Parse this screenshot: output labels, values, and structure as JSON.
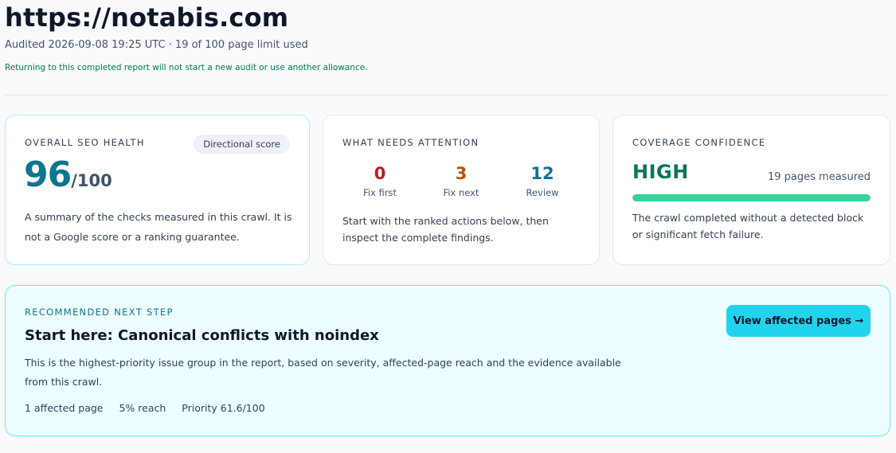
{
  "header": {
    "site_url": "https://notabis.com",
    "audit_meta": "Audited 2026-09-08 19:25 UTC · 19 of 100 page limit used",
    "note": "Returning to this completed report will not start a new audit or use another allowance."
  },
  "health": {
    "title": "OVERALL SEO HEALTH",
    "badge": "Directional score",
    "score": "96",
    "score_max": "/100",
    "description": "A summary of the checks measured in this crawl. It is not a Google score or a ranking guarantee."
  },
  "attention": {
    "title": "WHAT NEEDS ATTENTION",
    "counts": [
      {
        "value": "0",
        "label": "Fix first"
      },
      {
        "value": "3",
        "label": "Fix next"
      },
      {
        "value": "12",
        "label": "Review"
      }
    ],
    "description": "Start with the ranked actions below, then inspect the complete findings."
  },
  "coverage": {
    "title": "COVERAGE CONFIDENCE",
    "level": "HIGH",
    "pages_measured": "19 pages measured",
    "progress": 1.0,
    "description": "The crawl completed without a detected block or significant fetch failure."
  },
  "next_step": {
    "eyebrow": "RECOMMENDED NEXT STEP",
    "title": "Start here: Canonical conflicts with noindex",
    "description": "This is the highest-priority issue group in the report, based on severity, affected-page reach and the evidence available from this crawl.",
    "affected": "1 affected page",
    "reach": "5% reach",
    "priority": "Priority 61.6/100",
    "button_label": "View affected pages →"
  },
  "colors": {
    "accent": "#0e7490",
    "fix_first": "#b91c1c",
    "fix_next": "#b45309",
    "confidence": "#047857",
    "progress": "#34d399",
    "cta": "#22d3ee"
  }
}
